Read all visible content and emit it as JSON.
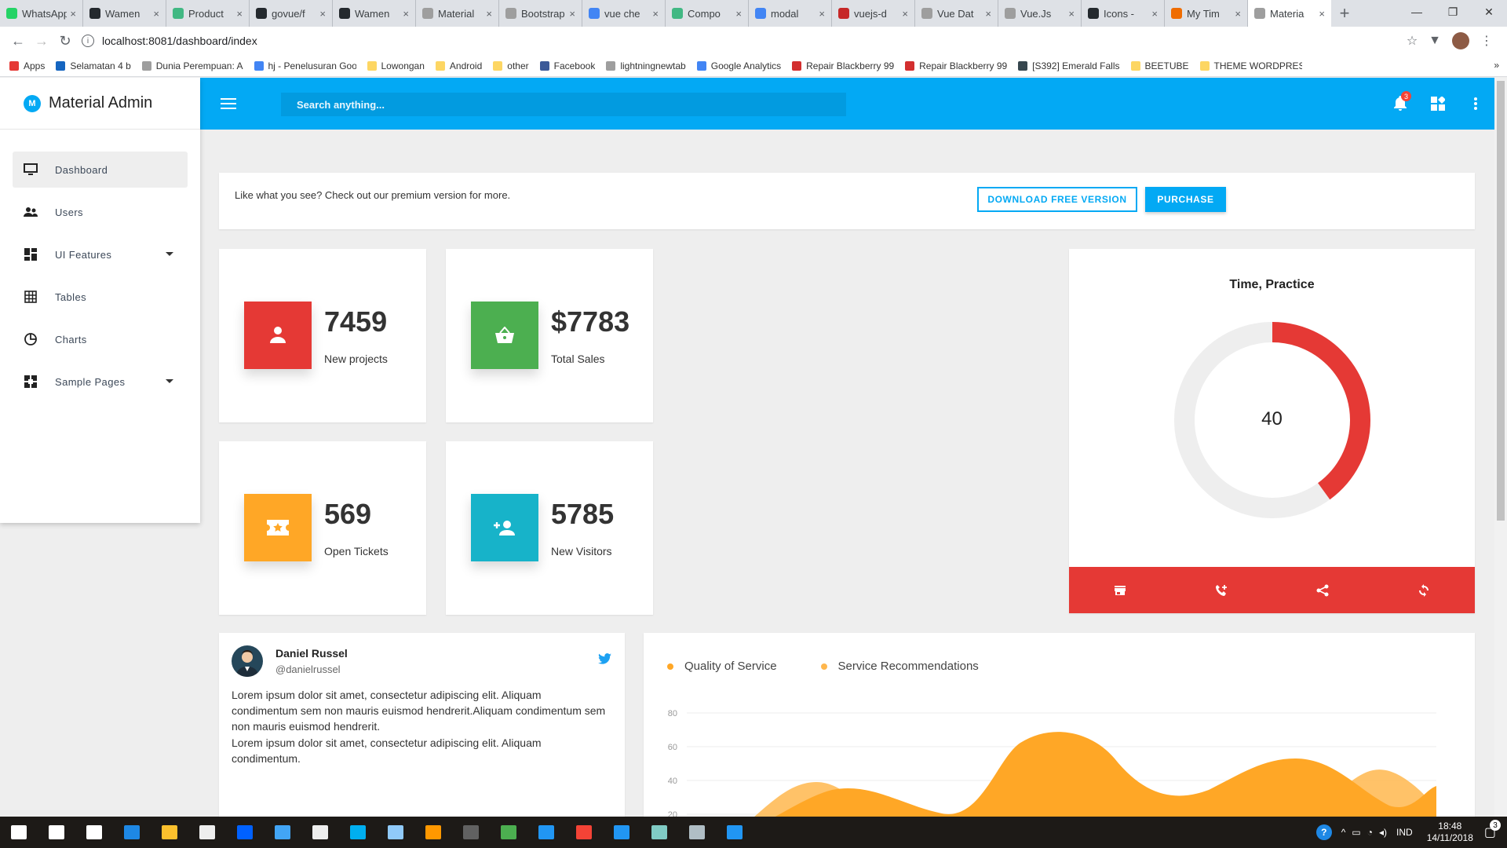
{
  "browser": {
    "tabs": [
      {
        "title": "WhatsApp",
        "color": "#25d366"
      },
      {
        "title": "Wamen",
        "color": "#24292e"
      },
      {
        "title": "Product",
        "color": "#41b883"
      },
      {
        "title": "govue/f",
        "color": "#24292e"
      },
      {
        "title": "Wamen",
        "color": "#24292e"
      },
      {
        "title": "Material",
        "color": "#9e9e9e"
      },
      {
        "title": "Bootstrap",
        "color": "#9e9e9e"
      },
      {
        "title": "vue che",
        "color": "#4285f4"
      },
      {
        "title": "Compo",
        "color": "#41b883"
      },
      {
        "title": "modal",
        "color": "#4285f4"
      },
      {
        "title": "vuejs-d",
        "color": "#c62828"
      },
      {
        "title": "Vue Dat",
        "color": "#9e9e9e"
      },
      {
        "title": "Vue.Js",
        "color": "#9e9e9e"
      },
      {
        "title": "Icons -",
        "color": "#24292e"
      },
      {
        "title": "My Tim",
        "color": "#ef6c00"
      }
    ],
    "active_tab": {
      "title": "Materia",
      "color": "#9e9e9e"
    },
    "close_glyph": "×",
    "new_tab_glyph": "+",
    "url": "localhost:8081/dashboard/index",
    "bookmarks": [
      {
        "label": "Apps",
        "color": "#e53935"
      },
      {
        "label": "Selamatan 4 b",
        "color": "#1565c0"
      },
      {
        "label": "Dunia Perempuan: A",
        "color": "#9e9e9e"
      },
      {
        "label": "hj - Penelusuran Goo",
        "color": "#4285f4"
      },
      {
        "label": "Lowongan",
        "color": "#fdd663"
      },
      {
        "label": "Android",
        "color": "#fdd663"
      },
      {
        "label": "other",
        "color": "#fdd663"
      },
      {
        "label": "Facebook",
        "color": "#3b5998"
      },
      {
        "label": "lightningnewtab",
        "color": "#9e9e9e"
      },
      {
        "label": "Google Analytics",
        "color": "#4285f4"
      },
      {
        "label": "Repair Blackberry 99",
        "color": "#d32f2f"
      },
      {
        "label": "Repair Blackberry 99",
        "color": "#d32f2f"
      },
      {
        "label": "[S392] Emerald Falls",
        "color": "#37474f"
      },
      {
        "label": "BEETUBE",
        "color": "#fdd663"
      },
      {
        "label": "THEME WORDPRESS",
        "color": "#fdd663"
      }
    ],
    "bookmarks_more": "»"
  },
  "app": {
    "brand_logo": "M",
    "brand_name": "Material Admin",
    "accent": "#03a9f4",
    "search_placeholder": "Search anything...",
    "notification_count": "3",
    "nav": [
      {
        "label": "Dashboard",
        "icon": "monitor-icon",
        "active": true,
        "caret": false
      },
      {
        "label": "Users",
        "icon": "people-icon",
        "active": false,
        "caret": false
      },
      {
        "label": "UI Features",
        "icon": "dashboard-icon",
        "active": false,
        "caret": true
      },
      {
        "label": "Tables",
        "icon": "grid-icon",
        "active": false,
        "caret": false
      },
      {
        "label": "Charts",
        "icon": "pie-chart-icon",
        "active": false,
        "caret": false
      },
      {
        "label": "Sample Pages",
        "icon": "pages-icon",
        "active": false,
        "caret": true
      }
    ],
    "promo": {
      "text": "Like what you see? Check out our premium version for more.",
      "download_label": "DOWNLOAD FREE VERSION",
      "purchase_label": "PURCHASE"
    },
    "stats": [
      {
        "value": "7459",
        "label": "New projects",
        "color": "#e53935",
        "icon": "person-icon"
      },
      {
        "value": "$7783",
        "label": "Total Sales",
        "color": "#4caf50",
        "icon": "basket-icon"
      },
      {
        "value": "569",
        "label": "Open Tickets",
        "color": "#ffa726",
        "icon": "ticket-icon"
      },
      {
        "value": "5785",
        "label": "New Visitors",
        "color": "#17b3c9",
        "icon": "add-person-icon"
      }
    ],
    "donut": {
      "title": "Time, Practice",
      "value": "40",
      "fraction": 0.4,
      "color": "#e53935",
      "track_color": "#eeeeee",
      "actions": [
        "store-icon",
        "add-call-icon",
        "share-icon",
        "sync-icon"
      ]
    },
    "profile": {
      "name": "Daniel Russel",
      "handle": "@danielrussel",
      "para1": "Lorem ipsum dolor sit amet, consectetur adipiscing elit. Aliquam condimentum sem non mauris euismod hendrerit.Aliquam condimentum sem non mauris euismod hendrerit.",
      "para2": "Lorem ipsum dolor sit amet, consectetur adipiscing elit. Aliquam condimentum."
    }
  },
  "chart_data": {
    "type": "area",
    "series": [
      {
        "name": "Quality of Service",
        "color": "#ffa726"
      },
      {
        "name": "Service Recommendations",
        "color": "#ffb74d"
      }
    ],
    "yticks": [
      "80",
      "60",
      "40",
      "20"
    ],
    "ylim": [
      0,
      80
    ],
    "grid": true,
    "legend": "top-left"
  },
  "taskbar": {
    "apps": [
      {
        "name": "windows-start-icon",
        "color": "#ffffff"
      },
      {
        "name": "search-icon",
        "color": "#ffffff"
      },
      {
        "name": "task-view-icon",
        "color": "#ffffff"
      },
      {
        "name": "edge-icon",
        "color": "#1e88e5"
      },
      {
        "name": "file-explorer-icon",
        "color": "#fbc02d"
      },
      {
        "name": "store-icon",
        "color": "#eeeeee"
      },
      {
        "name": "dropbox-icon",
        "color": "#0061ff"
      },
      {
        "name": "app-icon",
        "color": "#42a5f5"
      },
      {
        "name": "mail-icon",
        "color": "#eeeeee"
      },
      {
        "name": "skype-icon",
        "color": "#00aff0"
      },
      {
        "name": "app-icon",
        "color": "#90caf9"
      },
      {
        "name": "sublime-icon",
        "color": "#ff9800"
      },
      {
        "name": "terminal-icon",
        "color": "#616161"
      },
      {
        "name": "app-icon",
        "color": "#4caf50"
      },
      {
        "name": "ie-icon",
        "color": "#2196f3"
      },
      {
        "name": "chrome-icon",
        "color": "#f44336"
      },
      {
        "name": "maps-icon",
        "color": "#2196f3"
      },
      {
        "name": "app-icon",
        "color": "#80cbc4"
      },
      {
        "name": "app-icon",
        "color": "#b0bec5"
      },
      {
        "name": "vscode-icon",
        "color": "#2196f3"
      }
    ],
    "language": "IND",
    "time": "18:48",
    "date": "14/11/2018",
    "notifications": "3"
  }
}
